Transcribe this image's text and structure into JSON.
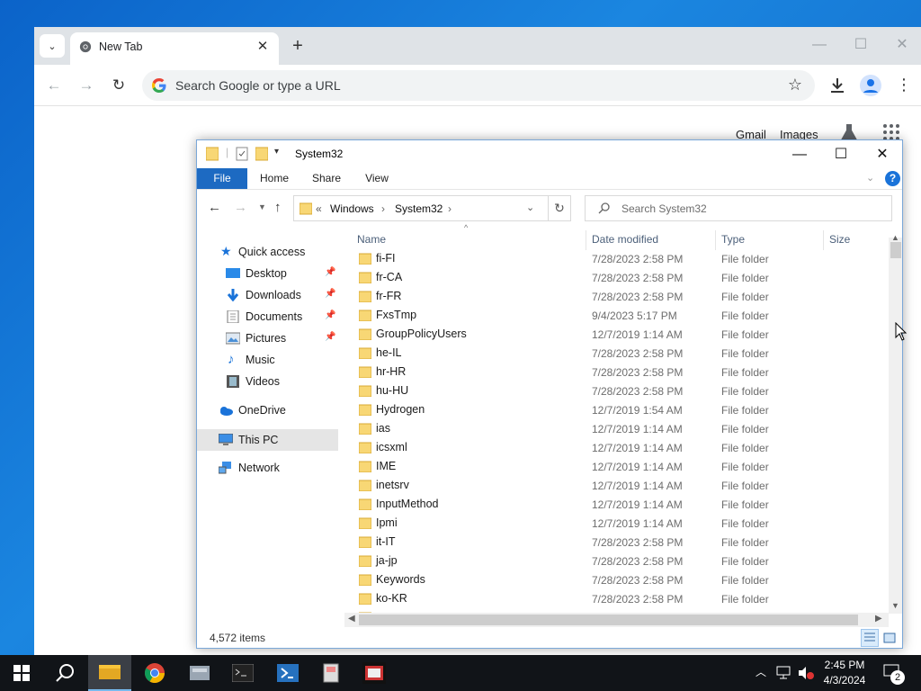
{
  "chrome": {
    "tab": {
      "title": "New Tab",
      "close": "✕"
    },
    "new_tab": "+",
    "window_controls": {
      "minimize": "—",
      "maximize": "☐",
      "close": "✕"
    },
    "nav": {
      "back": "←",
      "forward": "→",
      "reload": "↻"
    },
    "omnibox_placeholder": "Search Google or type a URL",
    "links": {
      "gmail": "Gmail",
      "images": "Images"
    },
    "menu": "⋮"
  },
  "explorer": {
    "title": "System32",
    "window_controls": {
      "minimize": "—",
      "maximize": "☐",
      "close": "✕"
    },
    "ribbon_tabs": {
      "file": "File",
      "home": "Home",
      "share": "Share",
      "view": "View"
    },
    "help": "?",
    "breadcrumb": {
      "prefix": "«",
      "items": [
        "Windows",
        "System32"
      ]
    },
    "search_placeholder": "Search System32",
    "navigation": {
      "quick_access": "Quick access",
      "desktop": "Desktop",
      "downloads": "Downloads",
      "documents": "Documents",
      "pictures": "Pictures",
      "music": "Music",
      "videos": "Videos",
      "onedrive": "OneDrive",
      "this_pc": "This PC",
      "network": "Network"
    },
    "columns": {
      "name": "Name",
      "date": "Date modified",
      "type": "Type",
      "size": "Size"
    },
    "files": [
      {
        "name": "fi-FI",
        "date": "7/28/2023 2:58 PM",
        "type": "File folder"
      },
      {
        "name": "fr-CA",
        "date": "7/28/2023 2:58 PM",
        "type": "File folder"
      },
      {
        "name": "fr-FR",
        "date": "7/28/2023 2:58 PM",
        "type": "File folder"
      },
      {
        "name": "FxsTmp",
        "date": "9/4/2023 5:17 PM",
        "type": "File folder"
      },
      {
        "name": "GroupPolicyUsers",
        "date": "12/7/2019 1:14 AM",
        "type": "File folder"
      },
      {
        "name": "he-IL",
        "date": "7/28/2023 2:58 PM",
        "type": "File folder"
      },
      {
        "name": "hr-HR",
        "date": "7/28/2023 2:58 PM",
        "type": "File folder"
      },
      {
        "name": "hu-HU",
        "date": "7/28/2023 2:58 PM",
        "type": "File folder"
      },
      {
        "name": "Hydrogen",
        "date": "12/7/2019 1:54 AM",
        "type": "File folder"
      },
      {
        "name": "ias",
        "date": "12/7/2019 1:14 AM",
        "type": "File folder"
      },
      {
        "name": "icsxml",
        "date": "12/7/2019 1:14 AM",
        "type": "File folder"
      },
      {
        "name": "IME",
        "date": "12/7/2019 1:14 AM",
        "type": "File folder"
      },
      {
        "name": "inetsrv",
        "date": "12/7/2019 1:14 AM",
        "type": "File folder"
      },
      {
        "name": "InputMethod",
        "date": "12/7/2019 1:14 AM",
        "type": "File folder"
      },
      {
        "name": "Ipmi",
        "date": "12/7/2019 1:14 AM",
        "type": "File folder"
      },
      {
        "name": "it-IT",
        "date": "7/28/2023 2:58 PM",
        "type": "File folder"
      },
      {
        "name": "ja-jp",
        "date": "7/28/2023 2:58 PM",
        "type": "File folder"
      },
      {
        "name": "Keywords",
        "date": "7/28/2023 2:58 PM",
        "type": "File folder"
      },
      {
        "name": "ko-KR",
        "date": "7/28/2023 2:58 PM",
        "type": "File folder"
      }
    ],
    "status": "4,572 items"
  },
  "taskbar": {
    "time": "2:45 PM",
    "date": "4/3/2024",
    "notifications": "2"
  },
  "colors": {
    "accent": "#1d6ac2",
    "folder": "#f5c93b",
    "desktop": "#0b63c9",
    "taskbar": "#111418"
  }
}
